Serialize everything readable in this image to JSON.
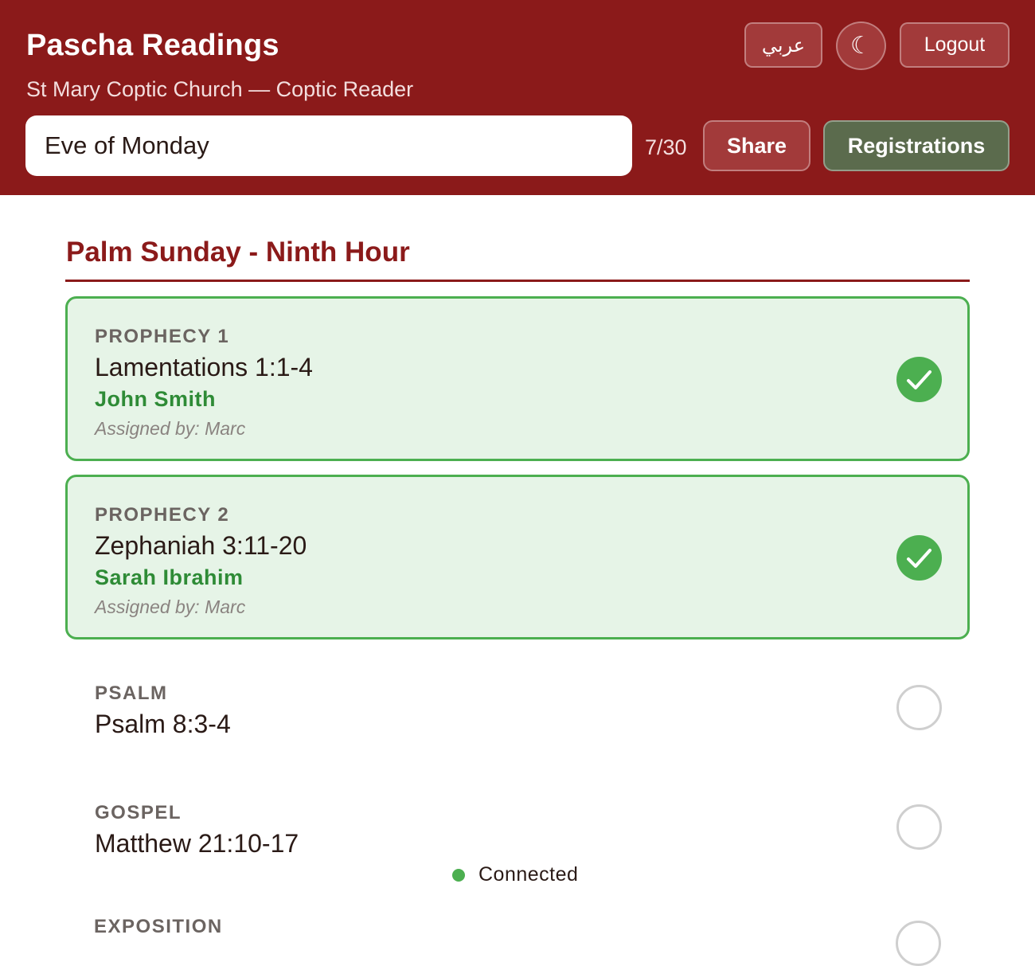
{
  "header": {
    "title": "Pascha Readings",
    "subtitle": "St Mary Coptic Church — Coptic Reader",
    "lang_label": "عربي",
    "theme_glyph": "☾",
    "theme_icon": "moon-icon",
    "logout_label": "Logout",
    "search_value": "Eve of Monday",
    "counter": "7/30",
    "share_label": "Share",
    "registrations_label": "Registrations"
  },
  "section": {
    "title": "Palm Sunday - Ninth Hour"
  },
  "readings": [
    {
      "kind": "PROPHECY 1",
      "reference": "Lamentations 1:1-4",
      "reader": "John Smith",
      "assigned_by": "Assigned by: Marc",
      "completed": true
    },
    {
      "kind": "PROPHECY 2",
      "reference": "Zephaniah 3:11-20",
      "reader": "Sarah Ibrahim",
      "assigned_by": "Assigned by: Marc",
      "completed": true
    },
    {
      "kind": "PSALM",
      "reference": "Psalm 8:3-4",
      "completed": false
    },
    {
      "kind": "GOSPEL",
      "reference": "Matthew 21:10-17",
      "completed": false
    }
  ],
  "next_reading_label": "EXPOSITION",
  "connection": {
    "status": "Connected",
    "color": "#4caf50"
  },
  "colors": {
    "brand": "#8b1a1a",
    "registrations_button": "#5b6b4d",
    "done_background": "#e6f4e7",
    "done_accent": "#4caf50",
    "reader_name": "#2e8b36"
  }
}
